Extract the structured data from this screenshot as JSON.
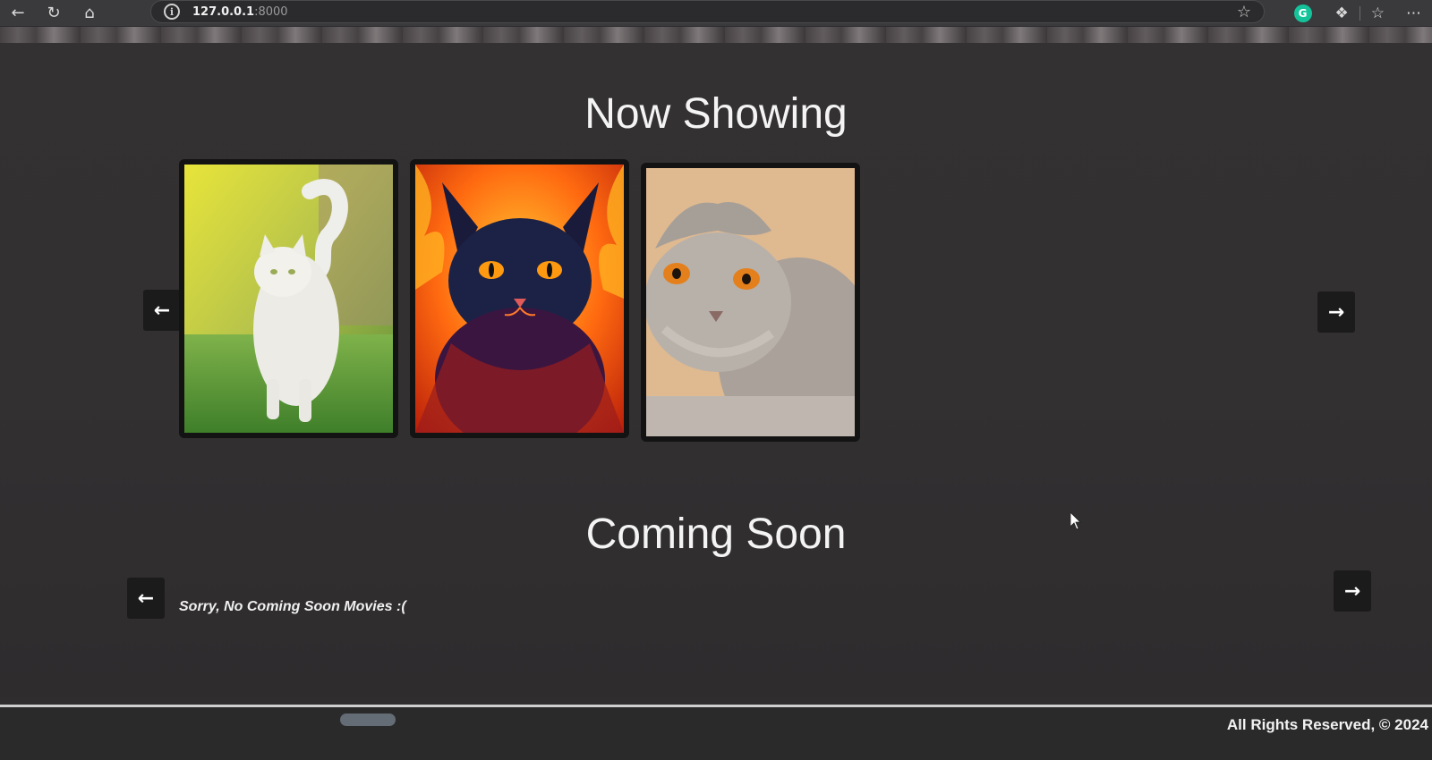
{
  "browser": {
    "url_host": "127.0.0.1",
    "url_port": ":8000",
    "icons": [
      "back-arrow-icon",
      "refresh-icon",
      "home-icon",
      "info-icon",
      "star-icon",
      "grammarly-icon",
      "extensions-icon",
      "favorites-icon",
      "more-icon"
    ]
  },
  "now_showing": {
    "title": "Now Showing",
    "prev_label": "←",
    "next_label": "→",
    "posters": [
      {
        "subject": "white cat walking on grass"
      },
      {
        "subject": "fiery cat illustration"
      },
      {
        "subject": "grey scottish fold cat"
      }
    ]
  },
  "coming_soon": {
    "title": "Coming Soon",
    "prev_label": "←",
    "next_label": "→",
    "empty_message": "Sorry, No Coming Soon Movies :("
  },
  "footer": {
    "text": "All Rights Reserved, © 2024"
  },
  "colors": {
    "page_bg": "#323031",
    "button_bg": "#1c1b1c",
    "text": "#f4f4f4"
  }
}
